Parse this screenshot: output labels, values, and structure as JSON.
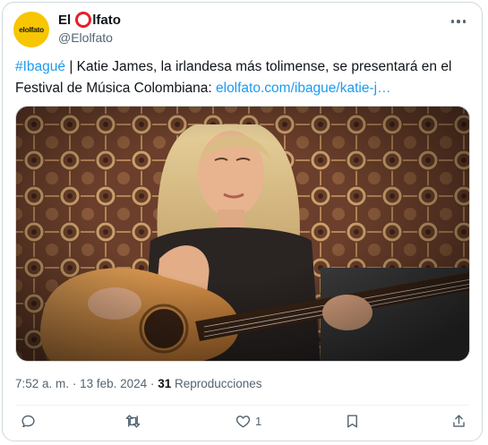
{
  "author": {
    "avatar_text": "elolfato",
    "name_part1": "El",
    "name_part2": "lfato",
    "handle": "@Elolfato"
  },
  "tweet": {
    "hashtag": "#Ibagué",
    "text": " | Katie James, la irlandesa más tolimense, se presentará en el Festival de Música Colombiana: ",
    "link": "elolfato.com/ibague/katie-j…"
  },
  "meta": {
    "time": "7:52 a. m.",
    "separator": "·",
    "date": "13 feb. 2024",
    "views_count": "31",
    "views_label": "Reproducciones"
  },
  "actions": {
    "reply_icon": "reply-icon",
    "retweet_icon": "retweet-icon",
    "like_icon": "heart-icon",
    "like_count": "1",
    "bookmark_icon": "bookmark-icon",
    "share_icon": "share-icon"
  },
  "colors": {
    "accent": "#1d9bf0",
    "brand_yellow": "#f7c600",
    "brand_red": "#e5202a",
    "text_muted": "#536471"
  }
}
